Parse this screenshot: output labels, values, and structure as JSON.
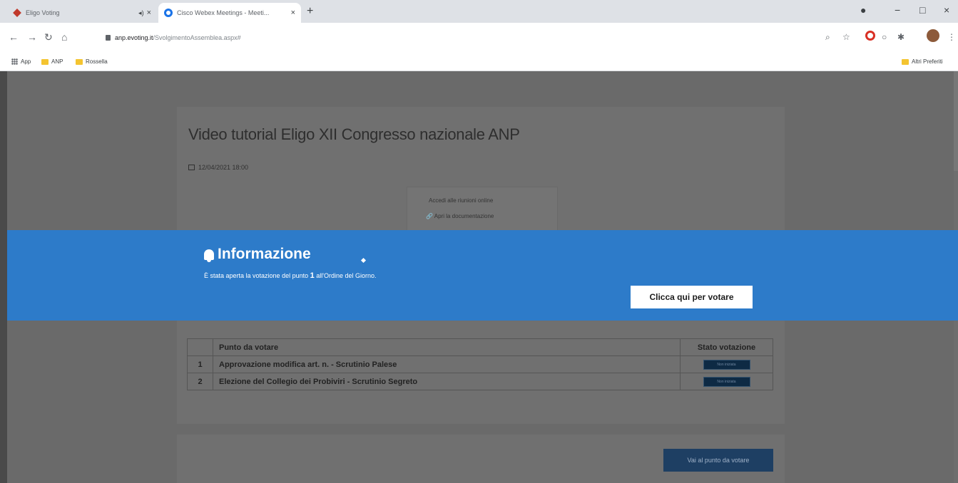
{
  "browser": {
    "tabs": [
      {
        "title": "Eligo Voting",
        "active": false
      },
      {
        "title": "Cisco Webex Meetings - Meeti...",
        "active": true
      }
    ],
    "url_host": "anp.evoting.it",
    "url_path": "/SvolgimentoAssemblea.aspx#",
    "bookmarks": [
      "App",
      "ANP",
      "Rossella"
    ],
    "other_bookmarks": "Altri Preferiti"
  },
  "page": {
    "title": "Video tutorial Eligo XII Congresso nazionale ANP",
    "date": "12/04/2021 18:00",
    "links": [
      "Accedi alle riunioni online",
      "Apri la documentazione"
    ],
    "table": {
      "headers": [
        "",
        "Punto da votare",
        "Stato votazione"
      ],
      "rows": [
        {
          "num": "1",
          "label": "Approvazione modifica art. n. - Scrutinio Palese",
          "status": "Non iniziata"
        },
        {
          "num": "2",
          "label": "Elezione del Collegio dei Probiviri - Scrutinio Segreto",
          "status": "Non iniziata"
        }
      ]
    },
    "goto_button": "Vai al punto da votare"
  },
  "banner": {
    "title": "Informazione",
    "text_before": "È stata aperta la votazione del punto ",
    "point_number": "1",
    "text_after": " all'Ordine del Giorno.",
    "button": "Clicca qui per votare"
  },
  "colors": {
    "banner": "#2d7bc9",
    "overlay": "#6a6a6a",
    "pill": "#0e2a44"
  }
}
